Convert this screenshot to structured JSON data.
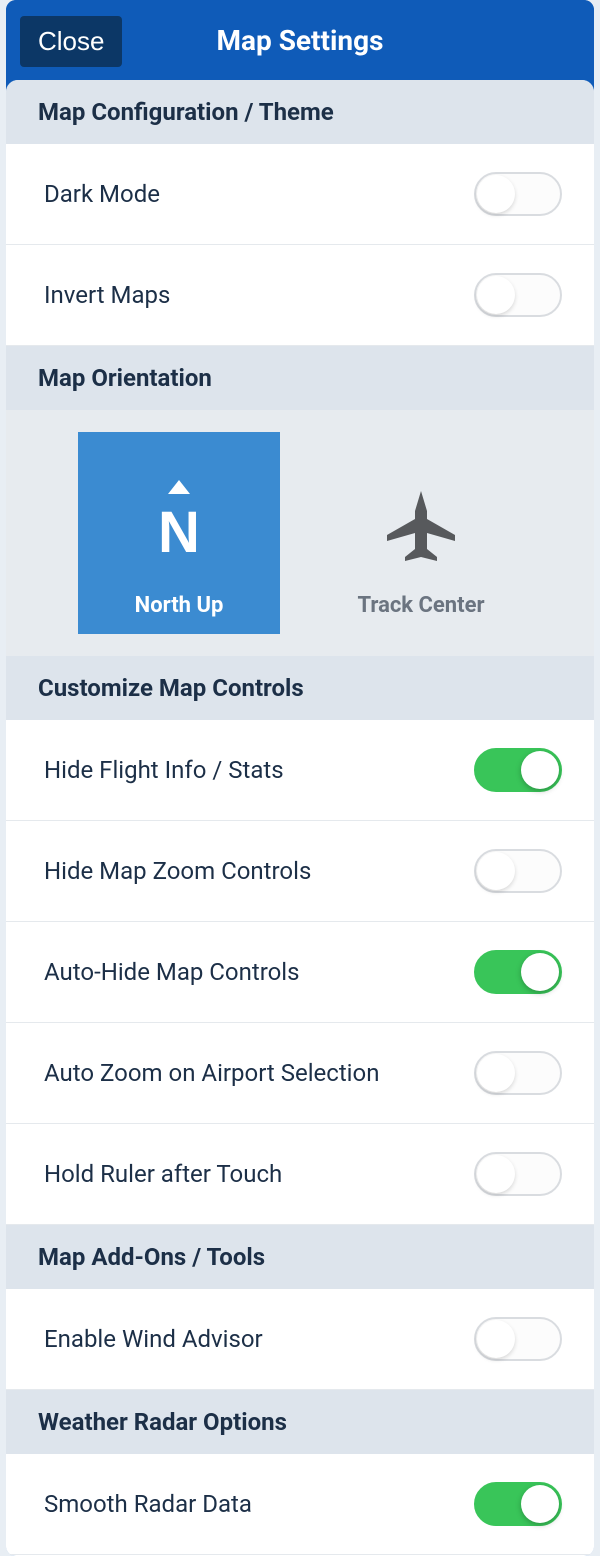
{
  "header": {
    "close": "Close",
    "title": "Map Settings"
  },
  "sections": {
    "config": {
      "title": "Map Configuration / Theme",
      "dark_mode": {
        "label": "Dark Mode",
        "on": false
      },
      "invert_maps": {
        "label": "Invert Maps",
        "on": false
      }
    },
    "orientation": {
      "title": "Map Orientation",
      "north_up": "North Up",
      "track_center": "Track Center",
      "selected": "north_up"
    },
    "controls": {
      "title": "Customize Map Controls",
      "hide_flight_info": {
        "label": "Hide Flight Info / Stats",
        "on": true
      },
      "hide_zoom": {
        "label": "Hide Map Zoom Controls",
        "on": false
      },
      "auto_hide": {
        "label": "Auto-Hide Map Controls",
        "on": true
      },
      "auto_zoom_airport": {
        "label": "Auto Zoom on Airport Selection",
        "on": false
      },
      "hold_ruler": {
        "label": "Hold Ruler after Touch",
        "on": false
      }
    },
    "addons": {
      "title": "Map Add-Ons / Tools",
      "wind_advisor": {
        "label": "Enable Wind Advisor",
        "on": false
      }
    },
    "radar": {
      "title": "Weather Radar Options",
      "smooth_radar": {
        "label": "Smooth Radar Data",
        "on": true
      }
    }
  }
}
